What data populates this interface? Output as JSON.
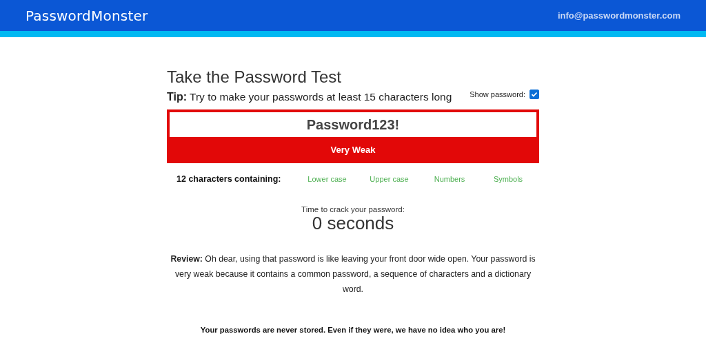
{
  "header": {
    "logo": "PasswordMonster",
    "email": "info@passwordmonster.com"
  },
  "title": "Take the Password Test",
  "tip": {
    "label": "Tip:",
    "text": "Try to make your passwords at least 15 characters long"
  },
  "show_password": {
    "label": "Show password:",
    "checked": true
  },
  "password": {
    "value": "Password123!"
  },
  "rating": {
    "label": "Very Weak",
    "kind": "very-weak"
  },
  "composition": {
    "label": "12 characters containing:",
    "classes": [
      {
        "label": "Lower case",
        "present": true
      },
      {
        "label": "Upper case",
        "present": true
      },
      {
        "label": "Numbers",
        "present": true
      },
      {
        "label": "Symbols",
        "present": true
      }
    ]
  },
  "crack_time": {
    "label": "Time to crack your password:",
    "value": "0 seconds"
  },
  "review": "**Review:** Oh dear, using that password is like leaving your front door wide open. Your password is very weak because it contains a common password, a sequence of characters and a dictionary word.",
  "footer": "Your passwords are never stored. Even if they were, we have no idea who you are!"
}
